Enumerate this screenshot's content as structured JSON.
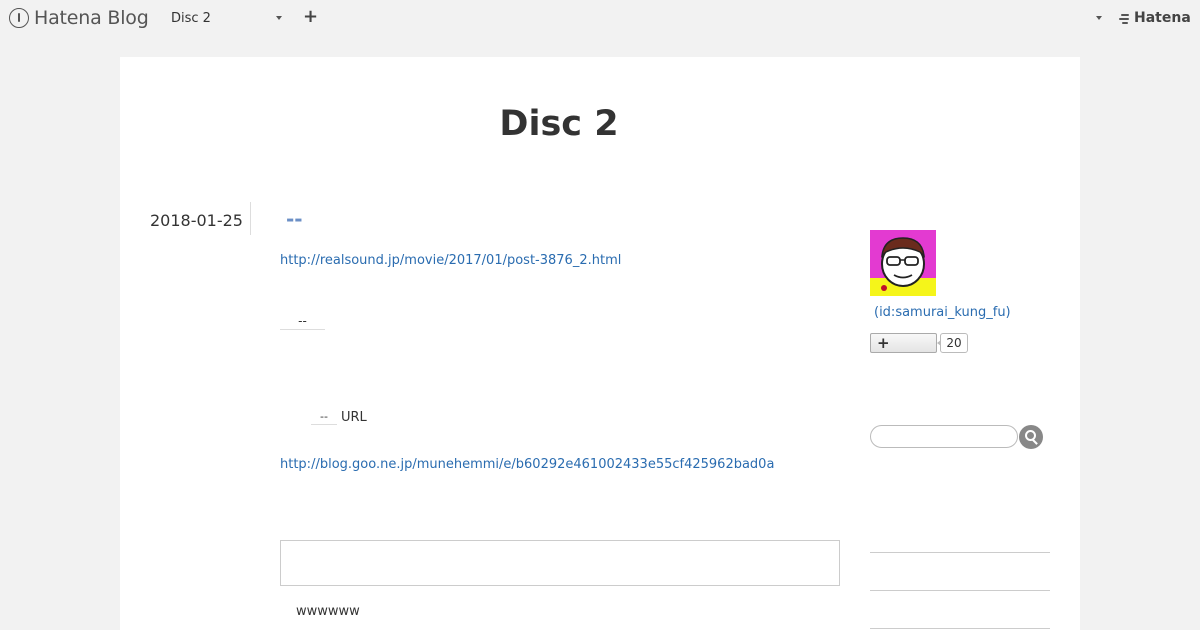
{
  "topbar": {
    "brand_name": "Hatena Blog",
    "blog_selector_value": "Disc 2",
    "add_label": "+",
    "hatena_logo_text": "Hatena"
  },
  "blog": {
    "title": "Disc 2"
  },
  "entry": {
    "date": "2018-01-25",
    "title": "--",
    "link_1": "http://realsound.jp/movie/2017/01/post-3876_2.html",
    "dashes": "--",
    "url_dash": "--",
    "url_label": "URL",
    "link_2": "http://blog.goo.ne.jp/munehemmi/e/b60292e461002433e55cf425962bad0a",
    "comment_text": "wwwwww"
  },
  "sidebar": {
    "profile_id": "(id:samurai_kung_fu)",
    "subscribe_label": "+",
    "subscribe_count": "20",
    "search_placeholder": ""
  },
  "colors": {
    "link": "#2a6cb0",
    "entry_title": "#6b8fc6",
    "avatar_bg": "#e33ad1",
    "avatar_shirt": "#f5f51a"
  },
  "icons": {
    "brand": "hatena-blog-logo-icon",
    "caret": "chevron-down-icon",
    "add": "plus-icon",
    "search": "search-icon"
  }
}
